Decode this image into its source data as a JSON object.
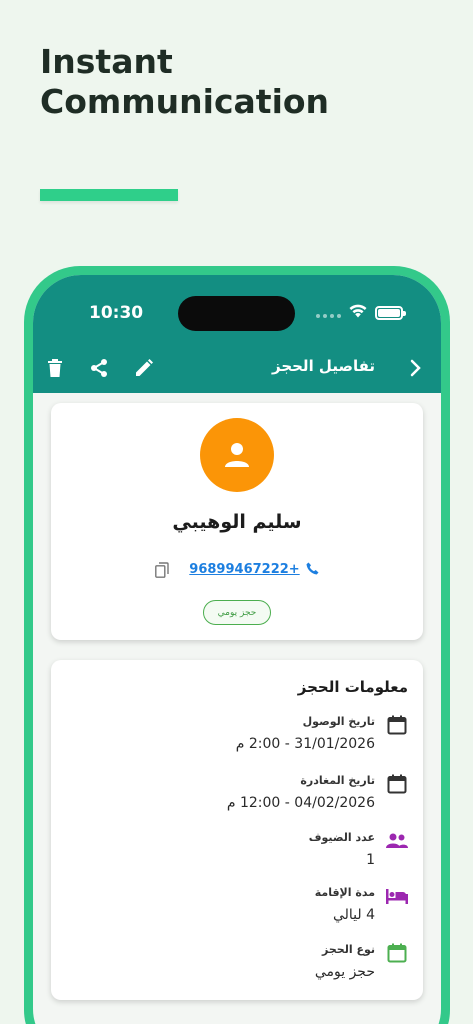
{
  "headline": {
    "line1": "Instant",
    "line2": "Communication"
  },
  "status_bar": {
    "time": "10:30"
  },
  "app_bar": {
    "title": "تفاصيل الحجز",
    "icons": [
      "delete-icon",
      "share-icon",
      "edit-icon",
      "chevron-right-icon"
    ]
  },
  "profile": {
    "name": "سليم الوهيبي",
    "phone": "96899467222+",
    "badge": "حجز يومي",
    "avatar_color": "#fb9507"
  },
  "booking_info": {
    "title": "معلومات الحجز",
    "rows": [
      {
        "label": "تاريخ الوصول",
        "value": "31/01/2026 - 2:00 م",
        "icon": "calendar-icon"
      },
      {
        "label": "تاريخ المغادرة",
        "value": "04/02/2026 - 12:00 م",
        "icon": "calendar-icon"
      },
      {
        "label": "عدد الضيوف",
        "value": "1",
        "icon": "people-icon"
      },
      {
        "label": "مدة الإقامة",
        "value": "4 ليالي",
        "icon": "bed-icon"
      },
      {
        "label": "نوع الحجز",
        "value": "حجز يومي",
        "icon": "calendar-green-icon"
      }
    ]
  },
  "colors": {
    "brand_teal": "#138e82",
    "frame_green": "#33c98a",
    "accent_bar": "#2fcf8a",
    "link_blue": "#1d7fe0",
    "badge_green": "#4cae4f",
    "purple_icon": "#9c27b0",
    "green_icon": "#4caf50"
  }
}
